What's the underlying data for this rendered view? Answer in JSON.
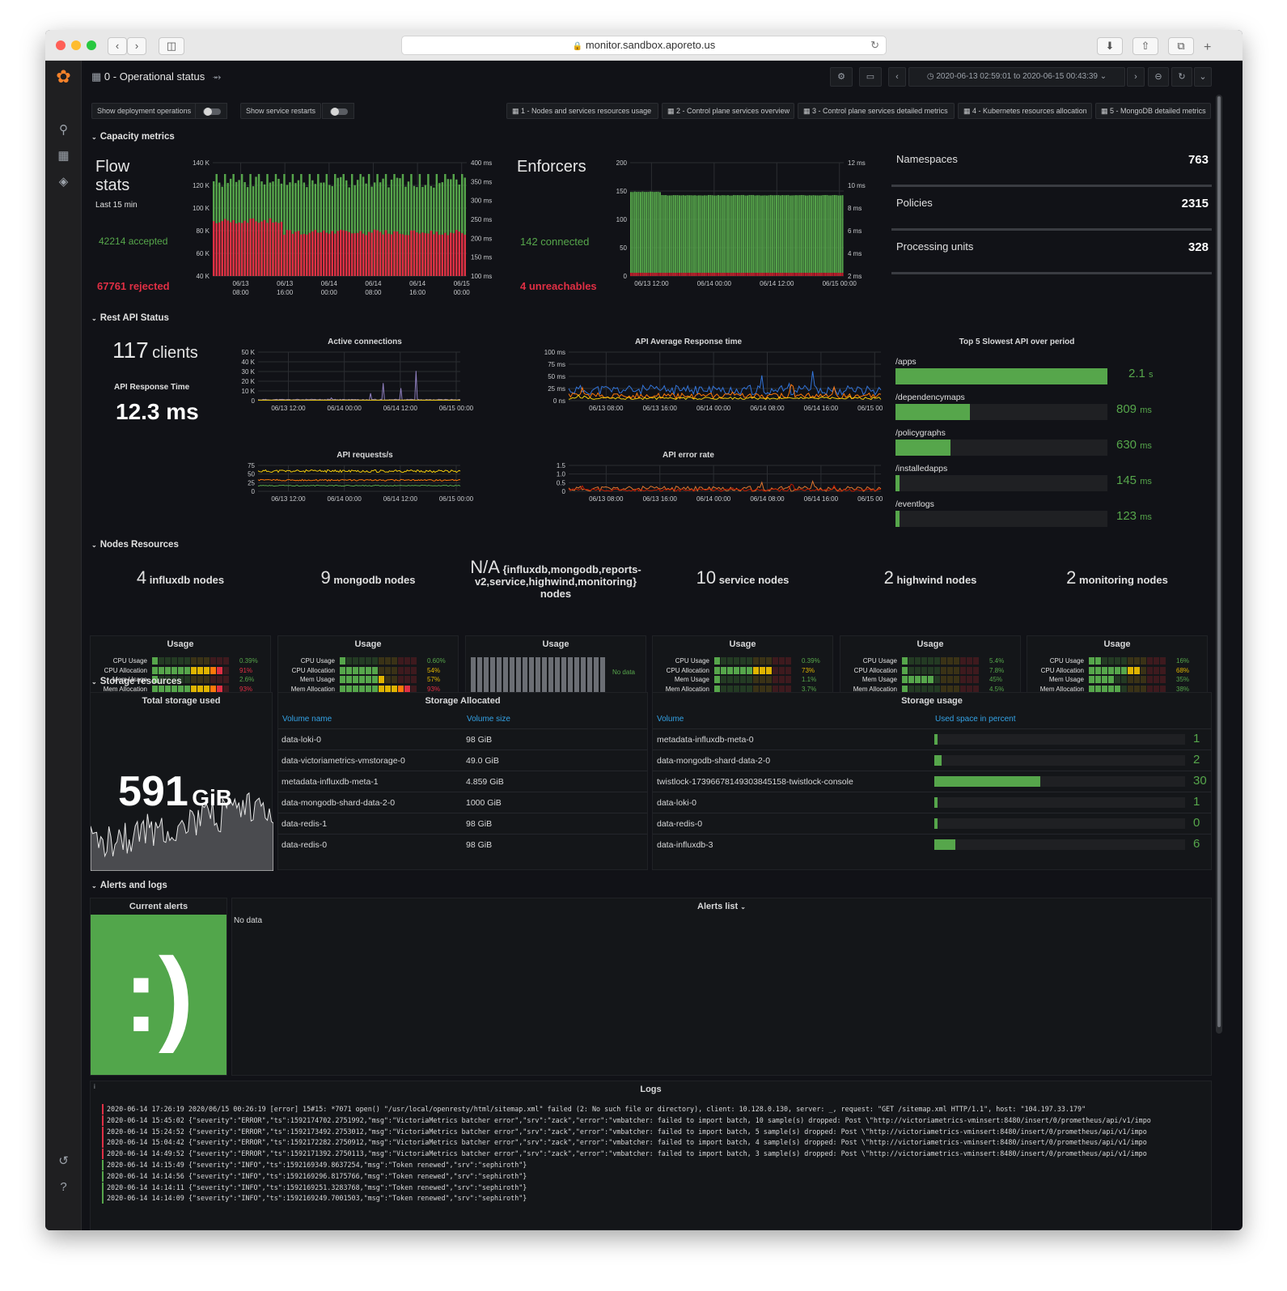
{
  "browser": {
    "url": "monitor.sandbox.aporeto.us"
  },
  "dashboard": {
    "title": "0 - Operational status",
    "time_range": "2020-06-13 02:59:01 to 2020-06-15 00:43:39"
  },
  "variables": {
    "deployment_ops": "Show deployment operations",
    "service_restarts": "Show service restarts"
  },
  "links": [
    "1 - Nodes and services resources usage",
    "2 - Control plane services overview",
    "3 - Control plane services detailed metrics",
    "4 - Kubernetes resources allocation",
    "5 - MongoDB detailed metrics"
  ],
  "rows": {
    "capacity": "Capacity metrics",
    "rest_api": "Rest API Status",
    "nodes": "Nodes Resources",
    "storage": "Storage resources",
    "alerts": "Alerts and logs"
  },
  "flow": {
    "title1": "Flow",
    "title2": "stats",
    "period": "Last 15 min",
    "accepted": "42214 accepted",
    "rejected": "67761 rejected"
  },
  "enforcers": {
    "title": "Enforcers",
    "connected": "142 connected",
    "unreachable": "4 unreachables"
  },
  "stats": [
    {
      "label": "Namespaces",
      "value": "763"
    },
    {
      "label": "Policies",
      "value": "2315"
    },
    {
      "label": "Processing units",
      "value": "328"
    }
  ],
  "api": {
    "clients_num": "117",
    "clients_unit": "clients",
    "resp_label": "API Response Time",
    "resp_value": "12.3 ms",
    "active_title": "Active connections",
    "avg_title": "API Average Response time",
    "req_title": "API requests/s",
    "err_title": "API error rate",
    "slow_title": "Top 5 Slowest API over period"
  },
  "slowest": [
    {
      "name": "/apps",
      "value": "2.1",
      "unit": "s",
      "fraction": 1.0
    },
    {
      "name": "/dependencymaps",
      "value": "809",
      "unit": "ms",
      "fraction": 0.35
    },
    {
      "name": "/policygraphs",
      "value": "630",
      "unit": "ms",
      "fraction": 0.26
    },
    {
      "name": "/installedapps",
      "value": "145",
      "unit": "ms",
      "fraction": 0.01
    },
    {
      "name": "/eventlogs",
      "value": "123",
      "unit": "ms",
      "fraction": 0.005
    }
  ],
  "nodes": [
    {
      "count": "4",
      "label": "influxdb nodes"
    },
    {
      "count": "9",
      "label": "mongodb nodes"
    },
    {
      "count": "N/A",
      "label": "{influxdb,mongodb,reports-v2,service,highwind,monitoring} nodes"
    },
    {
      "count": "10",
      "label": "service nodes"
    },
    {
      "count": "2",
      "label": "highwind nodes"
    },
    {
      "count": "2",
      "label": "monitoring nodes"
    }
  ],
  "usage_title": "Usage",
  "usage_labels": [
    "CPU Usage",
    "CPU Allocation",
    "Mem Usage",
    "Mem Allocation"
  ],
  "no_data_small": "No data",
  "usage_values": [
    {
      "values": [
        "0.39%",
        "91%",
        "2.6%",
        "93%"
      ],
      "fractions": [
        0.05,
        0.91,
        0.06,
        0.93
      ]
    },
    {
      "values": [
        "0.60%",
        "54%",
        "57%",
        "93%"
      ],
      "fractions": [
        0.05,
        0.54,
        0.57,
        0.93
      ]
    },
    null,
    {
      "values": [
        "0.39%",
        "73%",
        "1.1%",
        "3.7%"
      ],
      "fractions": [
        0.05,
        0.73,
        0.05,
        0.05
      ]
    },
    {
      "values": [
        "5.4%",
        "7.8%",
        "45%",
        "4.5%"
      ],
      "fractions": [
        0.08,
        0.1,
        0.45,
        0.06
      ]
    },
    {
      "values": [
        "16%",
        "68%",
        "35%",
        "38%"
      ],
      "fractions": [
        0.16,
        0.68,
        0.35,
        0.38
      ]
    }
  ],
  "storage": {
    "total_title": "Total storage used",
    "total_value": "591",
    "total_unit": "GiB",
    "alloc_title": "Storage Allocated",
    "usage_title": "Storage usage",
    "alloc_cols": [
      "Volume name",
      "Volume size"
    ],
    "alloc_rows": [
      [
        "data-loki-0",
        "98 GiB"
      ],
      [
        "data-victoriametrics-vmstorage-0",
        "49.0 GiB"
      ],
      [
        "metadata-influxdb-meta-1",
        "4.859 GiB"
      ],
      [
        "data-mongodb-shard-data-2-0",
        "1000 GiB"
      ],
      [
        "data-redis-1",
        "98 GiB"
      ],
      [
        "data-redis-0",
        "98 GiB"
      ]
    ],
    "usage_cols": [
      "Volume",
      "Used space in percent"
    ],
    "usage_rows": [
      {
        "name": "metadata-influxdb-meta-0",
        "value": "1",
        "pct": 1
      },
      {
        "name": "data-mongodb-shard-data-2-0",
        "value": "2",
        "pct": 2
      },
      {
        "name": "twistlock-17396678149303845158-twistlock-console",
        "value": "30",
        "pct": 30
      },
      {
        "name": "data-loki-0",
        "value": "1",
        "pct": 1
      },
      {
        "name": "data-redis-0",
        "value": "0",
        "pct": 0
      },
      {
        "name": "data-influxdb-3",
        "value": "6",
        "pct": 6
      }
    ]
  },
  "alerts": {
    "current_title": "Current alerts",
    "smile": ":)",
    "list_title": "Alerts list",
    "no_data": "No data",
    "logs_title": "Logs"
  },
  "logs": [
    {
      "level": "error",
      "text": "2020-06-14 17:26:19 2020/06/15 00:26:19 [error] 15#15: *7071 open() \"/usr/local/openresty/html/sitemap.xml\" failed (2: No such file or directory), client: 10.128.0.130, server: _, request: \"GET /sitemap.xml HTTP/1.1\", host: \"104.197.33.179\""
    },
    {
      "level": "error",
      "text": "2020-06-14 15:45:02 {\"severity\":\"ERROR\",\"ts\":1592174702.2751992,\"msg\":\"VictoriaMetrics batcher error\",\"srv\":\"zack\",\"error\":\"vmbatcher: failed to import batch, 10 sample(s) dropped: Post \\\"http://victoriametrics-vminsert:8480/insert/0/prometheus/api/v1/impo"
    },
    {
      "level": "error",
      "text": "2020-06-14 15:24:52 {\"severity\":\"ERROR\",\"ts\":1592173492.2753012,\"msg\":\"VictoriaMetrics batcher error\",\"srv\":\"zack\",\"error\":\"vmbatcher: failed to import batch, 5 sample(s) dropped: Post \\\"http://victoriametrics-vminsert:8480/insert/0/prometheus/api/v1/impo"
    },
    {
      "level": "error",
      "text": "2020-06-14 15:04:42 {\"severity\":\"ERROR\",\"ts\":1592172282.2750912,\"msg\":\"VictoriaMetrics batcher error\",\"srv\":\"zack\",\"error\":\"vmbatcher: failed to import batch, 4 sample(s) dropped: Post \\\"http://victoriametrics-vminsert:8480/insert/0/prometheus/api/v1/impo"
    },
    {
      "level": "error",
      "text": "2020-06-14 14:49:52 {\"severity\":\"ERROR\",\"ts\":1592171392.2750113,\"msg\":\"VictoriaMetrics batcher error\",\"srv\":\"zack\",\"error\":\"vmbatcher: failed to import batch, 3 sample(s) dropped: Post \\\"http://victoriametrics-vminsert:8480/insert/0/prometheus/api/v1/impo"
    },
    {
      "level": "info",
      "text": "2020-06-14 14:15:49 {\"severity\":\"INFO\",\"ts\":1592169349.8637254,\"msg\":\"Token renewed\",\"srv\":\"sephiroth\"}"
    },
    {
      "level": "info",
      "text": "2020-06-14 14:14:56 {\"severity\":\"INFO\",\"ts\":1592169296.8175766,\"msg\":\"Token renewed\",\"srv\":\"sephiroth\"}"
    },
    {
      "level": "info",
      "text": "2020-06-14 14:14:11 {\"severity\":\"INFO\",\"ts\":1592169251.3283768,\"msg\":\"Token renewed\",\"srv\":\"sephiroth\"}"
    },
    {
      "level": "info",
      "text": "2020-06-14 14:14:09 {\"severity\":\"INFO\",\"ts\":1592169249.7001503,\"msg\":\"Token renewed\",\"srv\":\"sephiroth\"}"
    }
  ],
  "chart_data": [
    {
      "type": "bar",
      "id": "flow",
      "y_ticks": [
        "40 K",
        "60 K",
        "80 K",
        "100 K",
        "120 K",
        "140 K"
      ],
      "y2_ticks": [
        "100 ms",
        "150 ms",
        "200 ms",
        "250 ms",
        "300 ms",
        "350 ms",
        "400 ms"
      ],
      "x_ticks": [
        "06/13 08:00",
        "06/13 16:00",
        "06/14 00:00",
        "06/14 08:00",
        "06/14 16:00",
        "06/15 00:00"
      ],
      "series": [
        {
          "name": "rejected",
          "color": "#e02f44",
          "approx_early": 68000,
          "approx_late": 65000
        },
        {
          "name": "accepted",
          "color": "#56a64b",
          "approx_total": 120000
        }
      ]
    },
    {
      "type": "bar",
      "id": "enforcers",
      "y_ticks": [
        "0",
        "50",
        "100",
        "150",
        "200"
      ],
      "y2_ticks": [
        "2 ms",
        "4 ms",
        "6 ms",
        "8 ms",
        "10 ms",
        "12 ms"
      ],
      "x_ticks": [
        "06/13 12:00",
        "06/14 00:00",
        "06/14 12:00",
        "06/15 00:00"
      ],
      "series": [
        {
          "name": "connected",
          "color": "#56a64b",
          "approx": 142
        },
        {
          "name": "unreachable",
          "color": "#e02f44",
          "approx": 4
        }
      ]
    },
    {
      "type": "line",
      "id": "active_connections",
      "y_ticks": [
        "0",
        "10 K",
        "20 K",
        "30 K",
        "40 K",
        "50 K"
      ],
      "x_ticks": [
        "06/13 12:00",
        "06/14 00:00",
        "06/14 12:00",
        "06/15 00:00"
      ]
    },
    {
      "type": "line",
      "id": "avg_response",
      "y_ticks": [
        "0 ns",
        "25 ms",
        "50 ms",
        "75 ms",
        "100 ms"
      ],
      "x_ticks": [
        "06/13 08:00",
        "06/13 16:00",
        "06/14 00:00",
        "06/14 08:00",
        "06/14 16:00",
        "06/15 00:00"
      ]
    },
    {
      "type": "line",
      "id": "requests",
      "y_ticks": [
        "0",
        "25",
        "50",
        "75"
      ],
      "x_ticks": [
        "06/13 12:00",
        "06/14 00:00",
        "06/14 12:00",
        "06/15 00:00"
      ]
    },
    {
      "type": "line",
      "id": "error_rate",
      "y_ticks": [
        "0",
        "0.5",
        "1.0",
        "1.5"
      ],
      "x_ticks": [
        "06/13 08:00",
        "06/13 16:00",
        "06/14 00:00",
        "06/14 08:00",
        "06/14 16:00",
        "06/15 00:00"
      ]
    }
  ]
}
